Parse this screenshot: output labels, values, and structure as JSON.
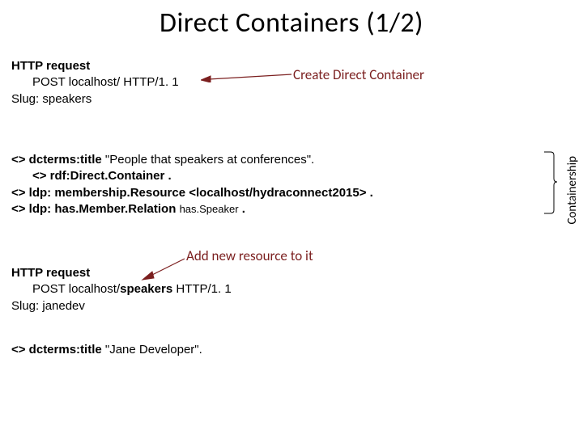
{
  "title": "Direct Containers (1/2)",
  "label_create": "Create Direct Container",
  "label_add": "Add new resource to it",
  "req1": {
    "heading": "HTTP request",
    "line1": "POST localhost/ HTTP/1. 1",
    "line2": "Slug: speakers"
  },
  "body1": {
    "l1a": "<> dcterms:title",
    "l1b": "\"People that speakers at conferences\".",
    "l2a": "<> rdf:Direct.Container .",
    "l3a": "<> ldp: membership.Resource <localhost/hydraconnect2015> .",
    "l4a": "<> ldp: has.Member.Relation",
    "l4b": "has.Speaker",
    "l4c": "."
  },
  "req2": {
    "heading": "HTTP request",
    "line1a": "POST localhost/",
    "line1b": "speakers",
    "line1c": " HTTP/1. 1",
    "line2": "Slug: janedev"
  },
  "body2": {
    "l1a": "<> dcterms:title",
    "l1b": "\"Jane Developer\"."
  },
  "side_label": "Containership"
}
